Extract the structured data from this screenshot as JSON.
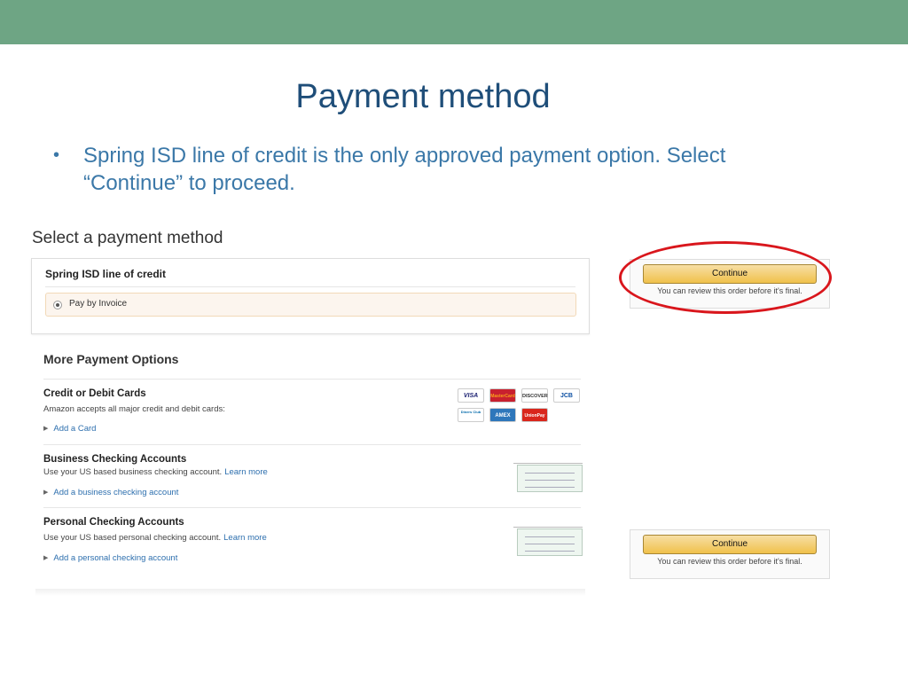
{
  "slide": {
    "title": "Payment method",
    "bullet_symbol": "•",
    "bullet": "Spring ISD line of credit is the only approved payment option.  Select “Continue” to proceed."
  },
  "screen": {
    "heading": "Select a payment method",
    "credit": {
      "title": "Spring ISD line of credit",
      "option_label": "Pay by Invoice"
    },
    "more_heading": "More Payment Options",
    "cards": {
      "title": "Credit or Debit Cards",
      "desc": "Amazon accepts all major credit and debit cards:",
      "add": "Add a Card",
      "logos": [
        "VISA",
        "MasterCard",
        "DISCOVER",
        "JCB",
        "Diners Club",
        "AMEX",
        "UnionPay"
      ]
    },
    "business": {
      "title": "Business Checking Accounts",
      "desc": "Use your US based business checking account.",
      "learn_more": "Learn more",
      "add": "Add a business checking account"
    },
    "personal": {
      "title": "Personal Checking Accounts",
      "desc": "Use your US based personal checking account.",
      "learn_more": "Learn more",
      "add": "Add a personal checking account"
    },
    "continue_top": {
      "button": "Continue",
      "note": "You can review this order before it's final."
    },
    "continue_bottom": {
      "button": "Continue",
      "note": "You can review this order before it's final."
    },
    "colors": {
      "header_bar": "#6ea584",
      "title": "#1f4e79",
      "bullet_text": "#3b78a8",
      "link": "#2d6fae",
      "highlight_oval": "#d9161c",
      "button_gold": "#f0c14b"
    }
  }
}
